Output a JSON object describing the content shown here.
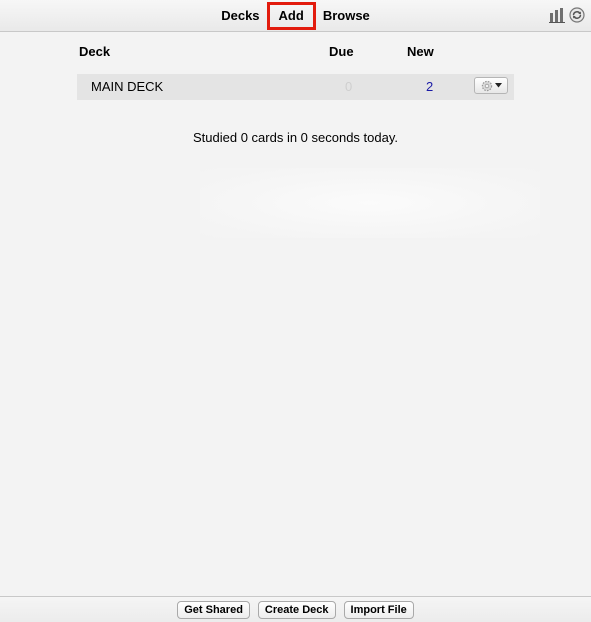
{
  "toolbar": {
    "nav": [
      "Decks",
      "Add",
      "Browse"
    ],
    "highlighted": "Add",
    "icons": [
      "stats-icon",
      "sync-icon"
    ]
  },
  "deck_table": {
    "headers": {
      "deck": "Deck",
      "due": "Due",
      "new": "New"
    },
    "rows": [
      {
        "name": "MAIN DECK",
        "due": "0",
        "new": "2"
      }
    ],
    "options_icon": "gear-icon"
  },
  "studied_text": "Studied 0 cards in 0 seconds today.",
  "footer": {
    "buttons": [
      "Get Shared",
      "Create Deck",
      "Import File"
    ]
  },
  "colors": {
    "highlight_border": "#e21b0d",
    "due_zero": "#cfcfcf",
    "new_count": "#1a1aa6",
    "row_background": "#e4e4e4"
  }
}
